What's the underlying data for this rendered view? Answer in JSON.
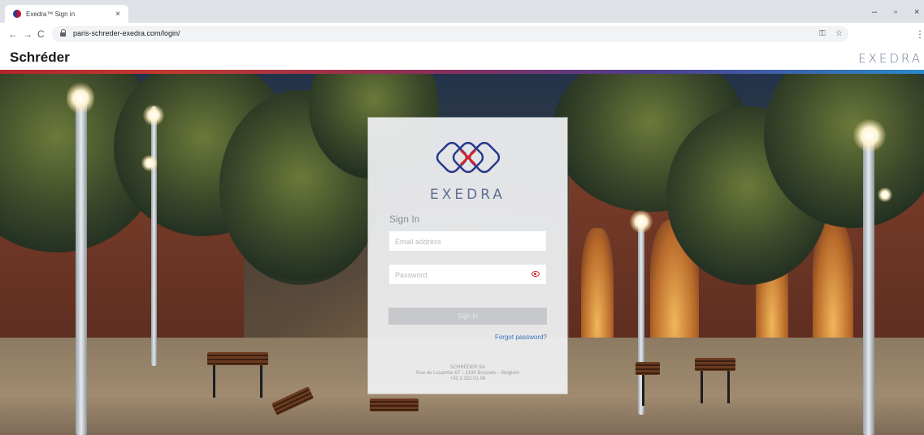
{
  "browser": {
    "tab_title": "Exedra™ Sign in",
    "tab_close": "×",
    "url": "paris-schreder-exedra.com/login/",
    "nav_back": "←",
    "nav_forward": "→",
    "nav_reload": "C",
    "window_minimize": "–",
    "window_restore": "▫",
    "window_close": "×",
    "key_icon": "⚿",
    "star_icon": "☆",
    "menu_icon": "⋮"
  },
  "header": {
    "brand": "Schréder",
    "product_mark": "EXEDRA"
  },
  "login": {
    "logo_word": "EXEDRA",
    "title": "Sign In",
    "email_placeholder": "Email address",
    "password_placeholder": "Password",
    "signin_label": "Sign In",
    "forgot_label": "Forgot password?",
    "footer": {
      "line1": "SCHRÉDER SA",
      "line2": "Rue de Lusambo 67 – 1190 Brussels – Belgium",
      "line3": "+32 2 332 01 06"
    }
  },
  "colors": {
    "brand_red": "#c8102e",
    "logo_blue": "#2a3a8c",
    "link_blue": "#3a72b8"
  },
  "icons": [
    "favicon",
    "lock-icon",
    "key-icon",
    "star-icon",
    "menu-icon",
    "eye-icon",
    "exedra-logo"
  ]
}
